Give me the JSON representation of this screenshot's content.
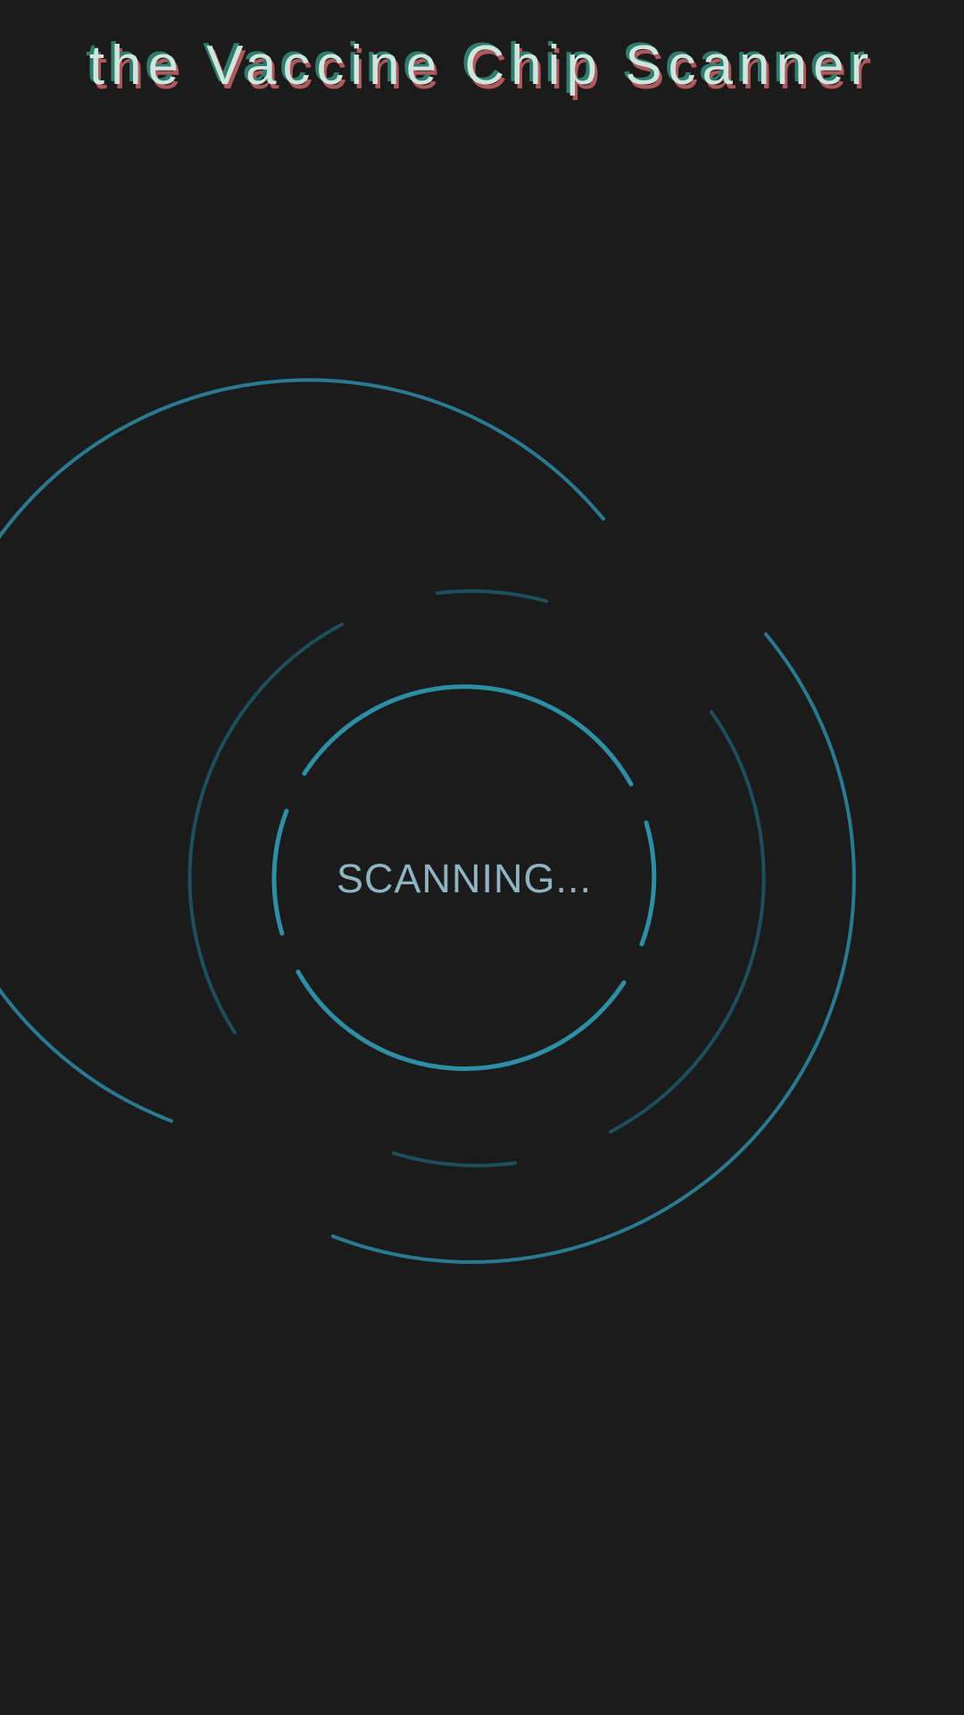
{
  "app": {
    "title": "the Vaccine Chip Scanner"
  },
  "scanner": {
    "status_text": "SCANNING...",
    "colors": {
      "background": "#1b1b1b",
      "ring_bright": "#2e8ea6",
      "ring_outer": "#2a7a92",
      "ring_dim": "#1d4f5e",
      "status_text": "#8fb4c3",
      "title_fill": "#cde6de",
      "title_shadow_teal": "#2f7d6e",
      "title_shadow_red": "#b0585a"
    }
  }
}
